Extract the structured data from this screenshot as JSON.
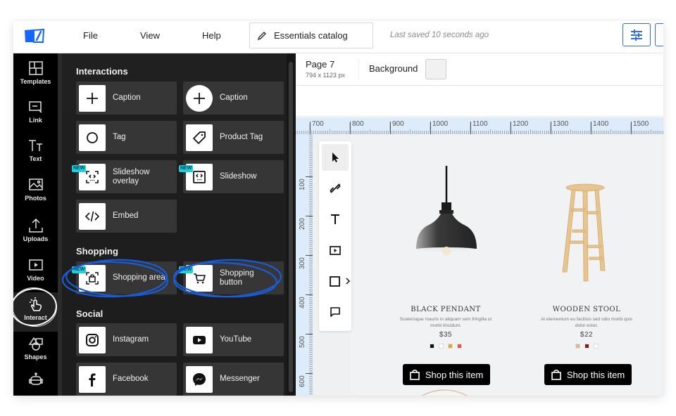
{
  "topbar": {
    "logo": "book-logo-icon",
    "menu": [
      "File",
      "View",
      "Help"
    ],
    "document_name": "Essentials catalog",
    "save_status": "Last saved 10 seconds ago",
    "settings_icon": "sliders-icon"
  },
  "rail": {
    "items": [
      {
        "label": "Templates",
        "icon": "templates-icon"
      },
      {
        "label": "Link",
        "icon": "link-cursor-icon"
      },
      {
        "label": "Text",
        "icon": "text-icon"
      },
      {
        "label": "Photos",
        "icon": "photo-icon"
      },
      {
        "label": "Uploads",
        "icon": "upload-icon"
      },
      {
        "label": "Video",
        "icon": "video-icon"
      },
      {
        "label": "Interact",
        "icon": "tap-hand-icon",
        "active": true
      },
      {
        "label": "Shapes",
        "icon": "shapes-icon"
      },
      {
        "label": "",
        "icon": "robot-icon"
      }
    ]
  },
  "panel": {
    "sections": [
      {
        "title": "Interactions",
        "items": [
          {
            "label": "Caption",
            "icon": "plus-square-icon",
            "new": false
          },
          {
            "label": "Caption",
            "icon": "plus-circle-icon",
            "new": false
          },
          {
            "label": "Tag",
            "icon": "circle-icon",
            "new": false
          },
          {
            "label": "Product Tag",
            "icon": "price-tag-icon",
            "new": false
          },
          {
            "label": "Slideshow overlay",
            "icon": "slideshow-overlay-icon",
            "new": true
          },
          {
            "label": "Slideshow",
            "icon": "slideshow-icon",
            "new": true
          },
          {
            "label": "Embed",
            "icon": "code-icon",
            "new": false
          }
        ]
      },
      {
        "title": "Shopping",
        "items": [
          {
            "label": "Shopping area",
            "icon": "shopping-bag-frame-icon",
            "new": true,
            "highlighted": true
          },
          {
            "label": "Shopping button",
            "icon": "cart-icon",
            "new": true,
            "highlighted": true
          }
        ]
      },
      {
        "title": "Social",
        "items": [
          {
            "label": "Instagram",
            "icon": "instagram-icon",
            "new": false
          },
          {
            "label": "YouTube",
            "icon": "youtube-icon",
            "new": false
          },
          {
            "label": "Facebook",
            "icon": "facebook-icon",
            "new": false
          },
          {
            "label": "Messenger",
            "icon": "messenger-icon",
            "new": false
          }
        ]
      }
    ],
    "new_badge": "NEW"
  },
  "canvas": {
    "page_title": "Page 7",
    "page_size": "794 x 1123 px",
    "background_label": "Background",
    "background_color": "#f1f1f1",
    "hruler_labels": [
      "700",
      "800",
      "900",
      "1000",
      "1100",
      "1200",
      "1300",
      "1400",
      "1500"
    ],
    "vruler_labels": [
      "100",
      "200",
      "300",
      "400",
      "500",
      "600"
    ],
    "tools": [
      {
        "name": "select-tool",
        "icon": "cursor-icon",
        "active": true
      },
      {
        "name": "link-tool",
        "icon": "link-icon"
      },
      {
        "name": "text-tool",
        "icon": "text-t-icon"
      },
      {
        "name": "video-tool",
        "icon": "play-box-icon"
      },
      {
        "name": "shape-tool",
        "icon": "square-icon"
      },
      {
        "name": "comment-tool",
        "icon": "speech-bubble-icon"
      }
    ]
  },
  "products": [
    {
      "name": "BLACK PENDANT",
      "description": "Scelerisque mauris in aliquam sem fringilla ut morbi tincidunt.",
      "price": "$35",
      "colors": [
        "#111111",
        "#ffffff",
        "#e5a532",
        "#ef5350"
      ],
      "button": "Shop this item"
    },
    {
      "name": "WOODEN STOOL",
      "description": "At elementum eu facilisis sed odio morbi quis dolor estet.",
      "price": "$22",
      "colors": [
        "#ddb97a",
        "#8b1a10",
        "#ffffff"
      ],
      "button": "Shop this item"
    }
  ],
  "colors": {
    "accent": "#2f6fd6",
    "logo_blue": "#1565ff",
    "badge_cyan": "#19d3dc",
    "annotation_blue": "#1a5cd6"
  }
}
